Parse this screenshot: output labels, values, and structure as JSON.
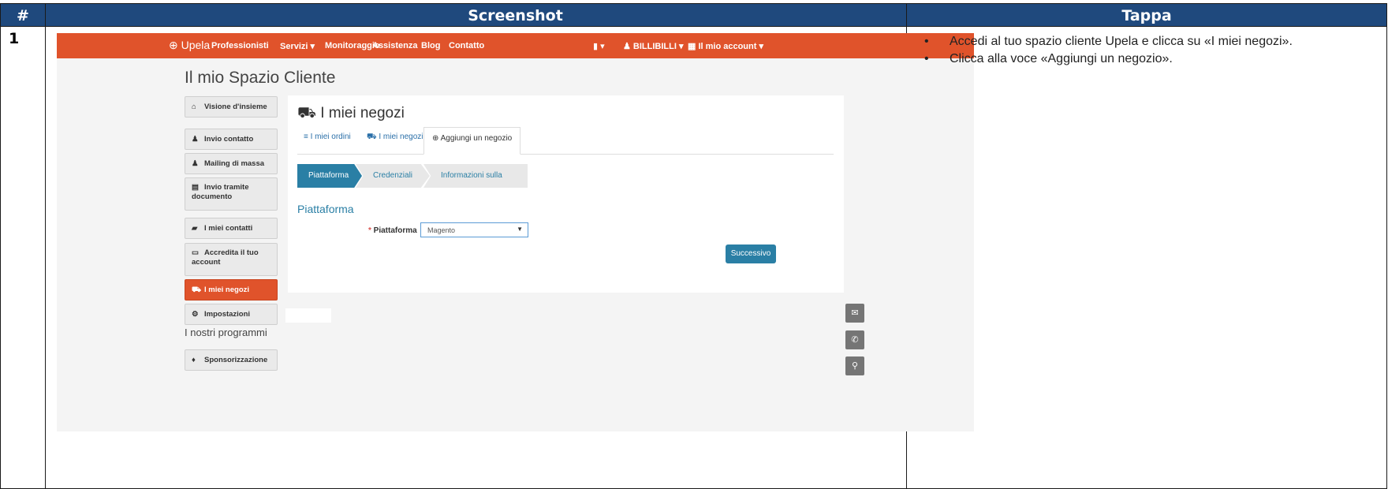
{
  "table": {
    "col_num": "#",
    "col_screenshot": "Screenshot",
    "col_tappa": "Tappa",
    "row_num": "1"
  },
  "screenshot": {
    "nav": {
      "brand": "Upela",
      "items": [
        "Professionisti",
        "Servizi ▾",
        "Monitoraggio",
        "Assistenza",
        "Blog",
        "Contatto"
      ],
      "lang": "▾",
      "user": "BILLIBILLI ▾",
      "account": "Il mio account ▾"
    },
    "page_title": "Il mio Spazio Cliente",
    "sidebar": {
      "items": [
        {
          "label": "Visione d'insieme",
          "icon": "home-icon"
        },
        {
          "label": "Invio contatto",
          "icon": "user-icon"
        },
        {
          "label": "Mailing di massa",
          "icon": "users-icon"
        },
        {
          "label": "Invio tramite documento",
          "icon": "document-icon"
        },
        {
          "label": "I miei contatti",
          "icon": "book-icon"
        },
        {
          "label": "Accredita il tuo account",
          "icon": "card-icon"
        },
        {
          "label": "I miei negozi",
          "icon": "cart-icon"
        },
        {
          "label": "Impostazioni",
          "icon": "gear-icon"
        }
      ],
      "programs_heading": "I nostri programmi",
      "program_item": "Sponsorizzazione"
    },
    "panel": {
      "title": "I miei negozi",
      "tabs": [
        "I miei ordini",
        "I miei negozi",
        "Aggiungi un negozio"
      ],
      "wizard": [
        "Piattaforma",
        "Credenziali",
        "Informazioni sulla boutique"
      ],
      "section": "Piattaforma",
      "field_label": "Piattaforma",
      "field_value": "Magento",
      "next_button": "Successivo"
    },
    "accent": "#e0532b",
    "primary": "#2a7fa5"
  },
  "steps": [
    "Accedi al tuo spazio cliente Upela e clicca su «I miei negozi».",
    "Clicca alla voce «Aggiungi un negozio»."
  ]
}
